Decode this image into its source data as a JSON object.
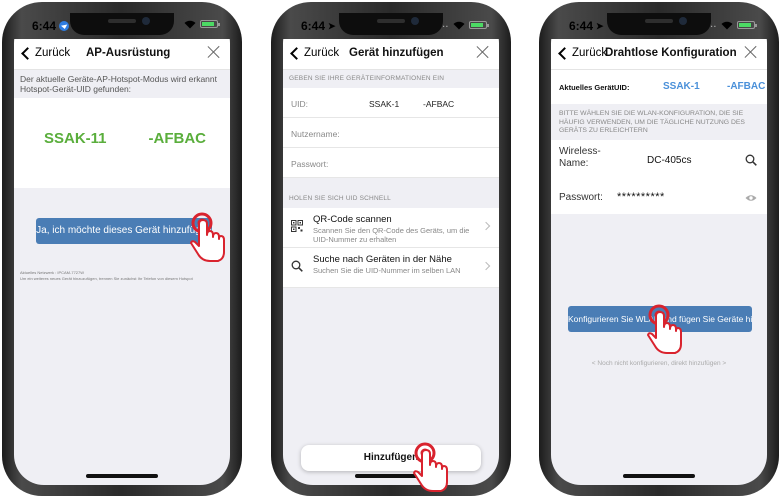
{
  "status": {
    "time": "6:44"
  },
  "phone1": {
    "nav": {
      "back": "Zurück",
      "title": "AP-Ausrüstung"
    },
    "info": "Der aktuelle Geräte-AP-Hotspot-Modus wird erkannt Hotspot-Gerät-UID gefunden:",
    "uid_part1": "SSAK-11",
    "uid_part2": "-AFBAC",
    "confirm_button": "Ja, ich möchte dieses Gerät hinzufügen",
    "network_line1": "Aktuelles Netzwerk : IPCAM-7727W",
    "network_line2": "Um ein weiteres neues Gerät hinzuzufügen, trennen Sie zunächst Ihr Telefon von diesem Hotspot"
  },
  "phone2": {
    "nav": {
      "back": "Zurück",
      "title": "Gerät hinzufügen"
    },
    "section1": "GEBEN SIE IHRE GERÄTEINFORMATIONEN EIN",
    "uid_label": "UID:",
    "uid_value1": "SSAK-1",
    "uid_value2": "-AFBAC",
    "username_label": "Nutzername:",
    "password_label": "Passwort:",
    "section2": "HOLEN SIE SICH UID SCHNELL",
    "qr_title": "QR-Code scannen",
    "qr_sub": "Scannen Sie den QR-Code des Geräts, um die UID-Nummer zu erhalten",
    "search_title": "Suche nach Geräten in der Nähe",
    "search_sub": "Suchen Sie die UID-Nummer im selben LAN",
    "add_button": "Hinzufügen"
  },
  "phone3": {
    "nav": {
      "back": "Zurück",
      "title": "Drahtlose Konfiguration"
    },
    "uid_label": "Aktuelles GerätUID:",
    "uid_value1": "SSAK-1",
    "uid_value2": "-AFBAC",
    "desc": "BITTE WÄHLEN SIE DIE WLAN-KONFIGURATION, DIE SIE HÄUFIG VERWENDEN, UM DIE TÄGLICHE NUTZUNG DES GERÄTS ZU ERLEICHTERN",
    "wifi_label": "Wireless-Name:",
    "wifi_value": "DC-405cs",
    "pass_label": "Passwort:",
    "pass_value": "**********",
    "config_button": "Konfigurieren Sie WLAN und fügen Sie Geräte hinzu",
    "skip": "< Noch nicht konfigurieren, direkt hinzufügen >"
  },
  "colors": {
    "accent_blue": "#4a7db5",
    "uid_green": "#5aae3c",
    "uid_blue": "#4a90d9",
    "hand_red": "#d9232e"
  }
}
